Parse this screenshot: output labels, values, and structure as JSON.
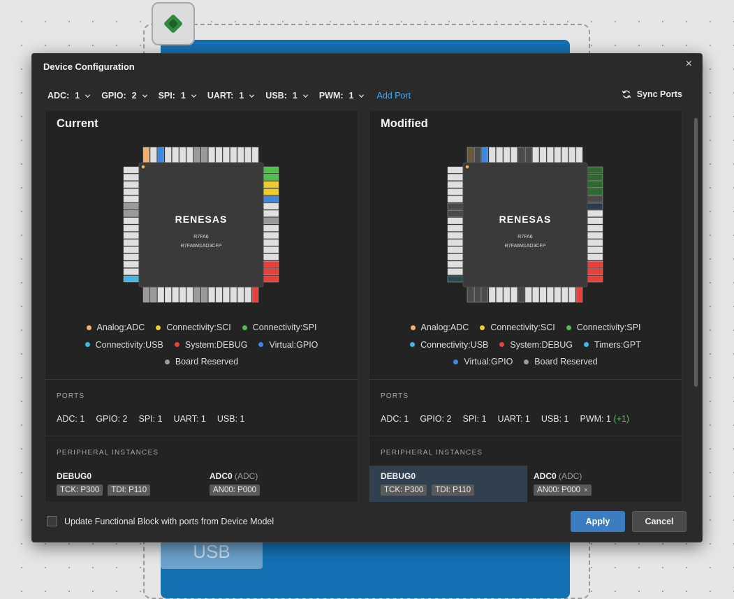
{
  "dialog": {
    "title": "Device Configuration",
    "close": "×"
  },
  "toolbar": {
    "ports": [
      {
        "name": "ADC:",
        "value": "1"
      },
      {
        "name": "GPIO:",
        "value": "2"
      },
      {
        "name": "SPI:",
        "value": "1"
      },
      {
        "name": "UART:",
        "value": "1"
      },
      {
        "name": "USB:",
        "value": "1"
      },
      {
        "name": "PWM:",
        "value": "1"
      }
    ],
    "add_port": "Add Port",
    "sync_ports": "Sync Ports"
  },
  "current": {
    "title": "Current",
    "chip": {
      "brand": "RENESAS",
      "family": "R7FA6",
      "part": "R7FA6M1AD3CFP"
    },
    "legend_rows": [
      [
        {
          "label": "Analog:ADC",
          "color": "#f2b06a"
        },
        {
          "label": "Connectivity:SCI",
          "color": "#f0cc2a"
        },
        {
          "label": "Connectivity:SPI",
          "color": "#4cc04a"
        }
      ],
      [
        {
          "label": "Connectivity:USB",
          "color": "#46b8e0"
        },
        {
          "label": "System:DEBUG",
          "color": "#e8413c"
        },
        {
          "label": "Virtual:GPIO",
          "color": "#3f88dd"
        }
      ],
      [
        {
          "label": "Board Reserved",
          "color": "#9a9a9a"
        }
      ]
    ],
    "ports_label": "PORTS",
    "ports": [
      {
        "name": "ADC:",
        "value": "1"
      },
      {
        "name": "GPIO:",
        "value": "2"
      },
      {
        "name": "SPI:",
        "value": "1"
      },
      {
        "name": "UART:",
        "value": "1"
      },
      {
        "name": "USB:",
        "value": "1"
      }
    ],
    "peripheral_label": "PERIPHERAL INSTANCES",
    "instances": [
      {
        "name": "DEBUG0",
        "sub": "",
        "tags": [
          "TCK: P300",
          "TDI: P110"
        ]
      },
      {
        "name": "ADC0",
        "sub": "(ADC)",
        "tags": [
          "AN00: P000"
        ]
      }
    ]
  },
  "modified": {
    "title": "Modified",
    "chip": {
      "brand": "RENESAS",
      "family": "R7FA6",
      "part": "R7FA6M1AD3CFP"
    },
    "legend_rows": [
      [
        {
          "label": "Analog:ADC",
          "color": "#f2b06a"
        },
        {
          "label": "Connectivity:SCI",
          "color": "#f0cc2a"
        },
        {
          "label": "Connectivity:SPI",
          "color": "#4cc04a"
        }
      ],
      [
        {
          "label": "Connectivity:USB",
          "color": "#46b8e0"
        },
        {
          "label": "System:DEBUG",
          "color": "#e8413c"
        },
        {
          "label": "Timers:GPT",
          "color": "#46b8e0"
        }
      ],
      [
        {
          "label": "Virtual:GPIO",
          "color": "#3f88dd"
        },
        {
          "label": "Board Reserved",
          "color": "#9a9a9a"
        }
      ]
    ],
    "ports_label": "PORTS",
    "ports": [
      {
        "name": "ADC:",
        "value": "1",
        "extra": ""
      },
      {
        "name": "GPIO:",
        "value": "2",
        "extra": ""
      },
      {
        "name": "SPI:",
        "value": "1",
        "extra": ""
      },
      {
        "name": "UART:",
        "value": "1",
        "extra": ""
      },
      {
        "name": "USB:",
        "value": "1",
        "extra": ""
      },
      {
        "name": "PWM:",
        "value": "1",
        "extra": "(+1)"
      }
    ],
    "peripheral_label": "PERIPHERAL INSTANCES",
    "instances": [
      {
        "name": "DEBUG0",
        "sub": "",
        "tags": [
          "TCK: P300",
          "TDI: P110"
        ],
        "removable": false
      },
      {
        "name": "ADC0",
        "sub": "(ADC)",
        "tags": [
          "AN00: P000"
        ],
        "removable": true
      }
    ]
  },
  "footer": {
    "checkbox_label": "Update Functional Block with ports from Device Model",
    "apply": "Apply",
    "cancel": "Cancel"
  },
  "background": {
    "usb_label": "USB"
  },
  "colors": {
    "accent": "#3b7dc0",
    "link": "#4aa8f0",
    "added": "#52c45a",
    "canvas_block": "#1570b2"
  }
}
